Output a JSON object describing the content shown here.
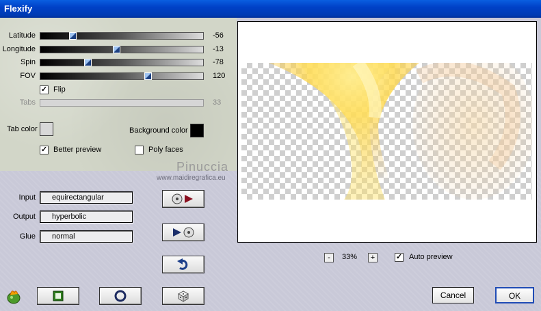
{
  "window": {
    "title": "Flexify"
  },
  "sliders": [
    {
      "label": "Latitude",
      "value": "-56",
      "fraction": 0.17
    },
    {
      "label": "Longitude",
      "value": "-13",
      "fraction": 0.45
    },
    {
      "label": "Spin",
      "value": "-78",
      "fraction": 0.27
    },
    {
      "label": "FOV",
      "value": "120",
      "fraction": 0.64
    }
  ],
  "flip": {
    "label": "Flip",
    "checked": true
  },
  "tabs": {
    "label": "Tabs",
    "value": "33"
  },
  "tab_color": {
    "label": "Tab color",
    "color": "#d8d8d8"
  },
  "background_color": {
    "label": "Background color",
    "color": "#000000"
  },
  "better_preview": {
    "label": "Better preview",
    "checked": true
  },
  "poly_faces": {
    "label": "Poly faces",
    "checked": false
  },
  "watermark": {
    "name": "Pinuccia",
    "url": "www.maidiregrafica.eu"
  },
  "input": {
    "label": "Input",
    "value": "equirectangular"
  },
  "output": {
    "label": "Output",
    "value": "hyperbolic"
  },
  "glue": {
    "label": "Glue",
    "value": "normal"
  },
  "zoom": {
    "minus": "-",
    "value": "33%",
    "plus": "+"
  },
  "auto_preview": {
    "label": "Auto preview",
    "checked": true
  },
  "buttons": {
    "cancel": "Cancel",
    "ok": "OK"
  },
  "icons": {
    "load": "disc-to-arrow-icon",
    "save": "arrow-to-disc-icon",
    "undo": "undo-arrow-icon",
    "logo": "flaming-pear-icon",
    "square": "square-icon",
    "circle": "circle-icon",
    "dice": "dice-icon"
  }
}
